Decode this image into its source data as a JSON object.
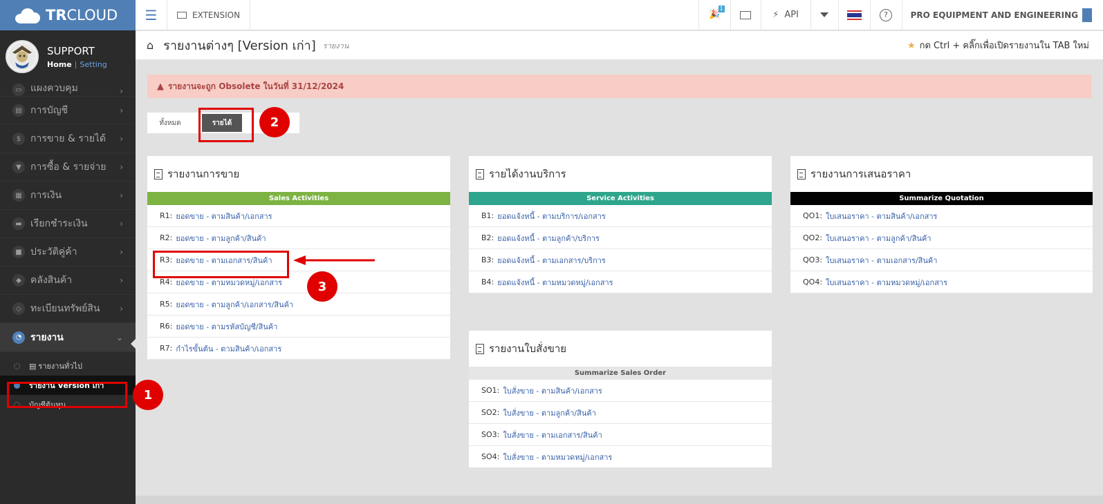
{
  "brand": {
    "bold": "TR",
    "rest": "CLOUD"
  },
  "user": {
    "name": "SUPPORT",
    "home": "Home",
    "separator": "|",
    "setting": "Setting"
  },
  "sidebar": {
    "items": [
      {
        "label": "แผงควบคุม",
        "icon": "monitor-icon"
      },
      {
        "label": "การบัญชี",
        "icon": "book-icon"
      },
      {
        "label": "การขาย & รายได้",
        "icon": "dollar-icon"
      },
      {
        "label": "การซื้อ & รายจ่าย",
        "icon": "cart-icon"
      },
      {
        "label": "การเงิน",
        "icon": "calendar-icon"
      },
      {
        "label": "เรียกชำระเงิน",
        "icon": "card-icon"
      },
      {
        "label": "ประวัติคู่ค้า",
        "icon": "contact-icon"
      },
      {
        "label": "คลังสินค้า",
        "icon": "cubes-icon"
      },
      {
        "label": "ทะเบียนทรัพย์สิน",
        "icon": "diamond-icon"
      },
      {
        "label": "รายงาน",
        "icon": "chart-icon"
      }
    ],
    "sub_items": [
      {
        "label": "รายงานทั่วไป"
      },
      {
        "label": "รายงาน Version เก่า"
      },
      {
        "label": "บัญชีต้นทุน"
      }
    ]
  },
  "topbar": {
    "extension": "EXTENSION",
    "badge": "1",
    "api": "API",
    "help": "?",
    "company": "PRO EQUIPMENT AND ENGINEERING"
  },
  "page": {
    "title": "รายงานต่างๆ [Version เก่า]",
    "subtitle": "รายงาน",
    "hint": "กด Ctrl + คลิ๊กเพื่อเปิดรายงานใน TAB ใหม่"
  },
  "alert": {
    "text": "รายงานจะถูก Obsolete ในวันที่ 31/12/2024"
  },
  "tabs": {
    "all": "ทั้งหมด",
    "income": "รายได้"
  },
  "panels": {
    "sales": {
      "title": "รายงานการขาย",
      "band": "Sales Activities",
      "band_color": "#7cb342",
      "rows": [
        {
          "code": "R1:",
          "label": "ยอดขาย - ตามสินค้า/เอกสาร"
        },
        {
          "code": "R2:",
          "label": "ยอดขาย - ตามลูกค้า/สินค้า"
        },
        {
          "code": "R3:",
          "label": "ยอดขาย - ตามเอกสาร/สินค้า"
        },
        {
          "code": "R4:",
          "label": "ยอดขาย - ตามหมวดหมู่/เอกสาร"
        },
        {
          "code": "R5:",
          "label": "ยอดขาย - ตามลูกค้า/เอกสาร/สินค้า"
        },
        {
          "code": "R6:",
          "label": "ยอดขาย - ตามรหัสบัญชี/สินค้า"
        },
        {
          "code": "R7:",
          "label": "กำไรขั้นต้น - ตามสินค้า/เอกสาร"
        }
      ]
    },
    "service": {
      "title": "รายได้งานบริการ",
      "band": "Service Activities",
      "band_color": "#2ea58c",
      "rows": [
        {
          "code": "B1:",
          "label": "ยอดแจ้งหนี้ - ตามบริการ/เอกสาร"
        },
        {
          "code": "B2:",
          "label": "ยอดแจ้งหนี้ - ตามลูกค้า/บริการ"
        },
        {
          "code": "B3:",
          "label": "ยอดแจ้งหนี้ - ตามเอกสาร/บริการ"
        },
        {
          "code": "B4:",
          "label": "ยอดแจ้งหนี้ - ตามหมวดหมู่/เอกสาร"
        }
      ]
    },
    "quote": {
      "title": "รายงานการเสนอราคา",
      "band": "Summarize Quotation",
      "band_color": "#000000",
      "rows": [
        {
          "code": "QO1:",
          "label": "ใบเสนอราคา - ตามสินค้า/เอกสาร"
        },
        {
          "code": "QO2:",
          "label": "ใบเสนอราคา - ตามลูกค้า/สินค้า"
        },
        {
          "code": "QO3:",
          "label": "ใบเสนอราคา - ตามเอกสาร/สินค้า"
        },
        {
          "code": "QO4:",
          "label": "ใบเสนอราคา - ตามหมวดหมู่/เอกสาร"
        }
      ]
    },
    "so": {
      "title": "รายงานใบสั่งขาย",
      "band": "Summarize Sales Order",
      "band_color": "#e6e6e6",
      "rows": [
        {
          "code": "SO1:",
          "label": "ใบสั่งขาย - ตามสินค้า/เอกสาร"
        },
        {
          "code": "SO2:",
          "label": "ใบสั่งขาย - ตามลูกค้า/สินค้า"
        },
        {
          "code": "SO3:",
          "label": "ใบสั่งขาย - ตามเอกสาร/สินค้า"
        },
        {
          "code": "SO4:",
          "label": "ใบสั่งขาย - ตามหมวดหมู่/เอกสาร"
        }
      ]
    }
  },
  "annotations": [
    "1",
    "2",
    "3"
  ],
  "colors": {
    "accent": "#4f7fb5",
    "annotation": "#e00000",
    "link": "#3a62a8"
  }
}
